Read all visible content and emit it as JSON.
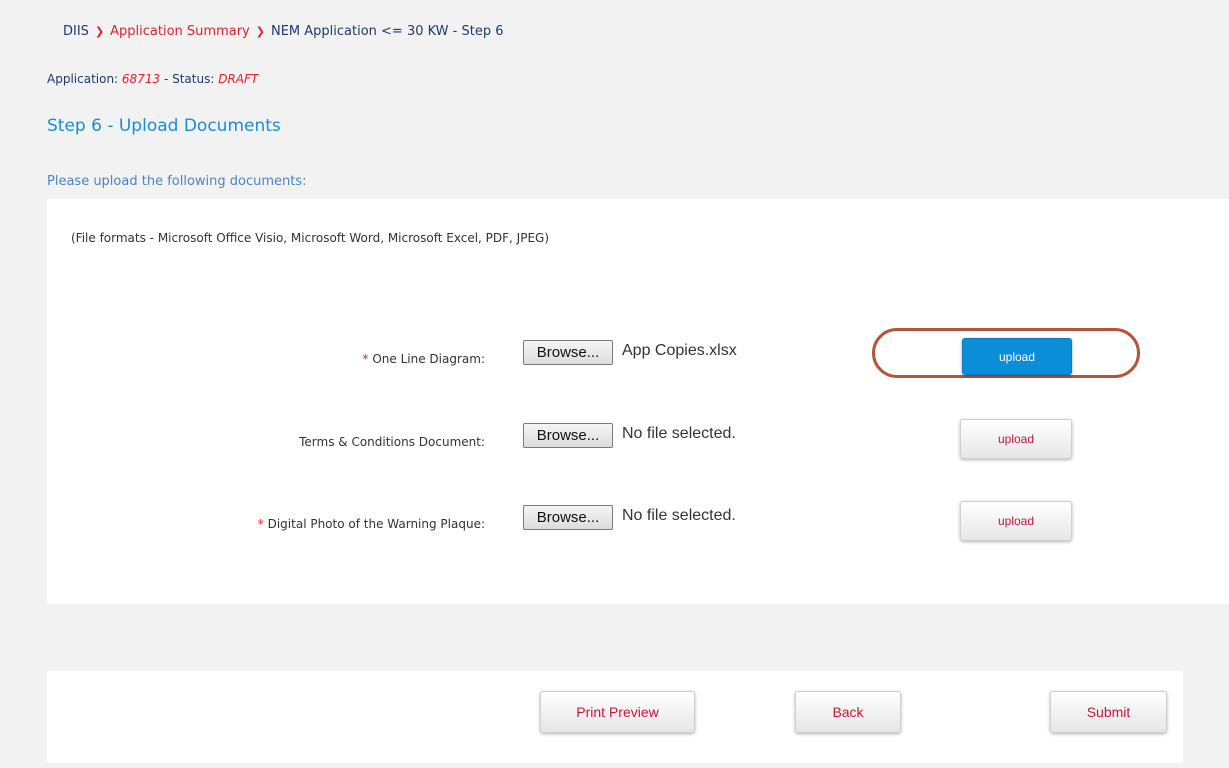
{
  "breadcrumb": {
    "root": "DIIS",
    "summary": "Application Summary",
    "current": "NEM Application <= 30 KW - Step 6",
    "separator": "❯"
  },
  "application": {
    "label": "Application:",
    "number": "68713",
    "status_label": "- Status:",
    "status": "DRAFT"
  },
  "step_title": "Step 6 - Upload Documents",
  "instruction": "Please upload the following documents:",
  "file_formats": "(File formats - Microsoft Office Visio, Microsoft Word, Microsoft Excel, PDF, JPEG)",
  "documents": [
    {
      "label": "One Line Diagram:",
      "required_mark": "*",
      "browse": "Browse...",
      "file": "App Copies.xlsx",
      "upload": "upload"
    },
    {
      "label": "Terms & Conditions Document:",
      "required_mark": "",
      "browse": "Browse...",
      "file": "No file selected.",
      "upload": "upload"
    },
    {
      "label": "Digital Photo of the Warning Plaque:",
      "required_mark": "*",
      "browse": "Browse...",
      "file": "No file selected.",
      "upload": "upload"
    }
  ],
  "footer": {
    "print_preview": "Print Preview",
    "back": "Back",
    "submit": "Submit"
  },
  "colors": {
    "accent_red": "#d9232e",
    "title_blue": "#1a8ed0",
    "active_upload": "#0a8ed8",
    "highlight_ring": "#b5533c"
  }
}
